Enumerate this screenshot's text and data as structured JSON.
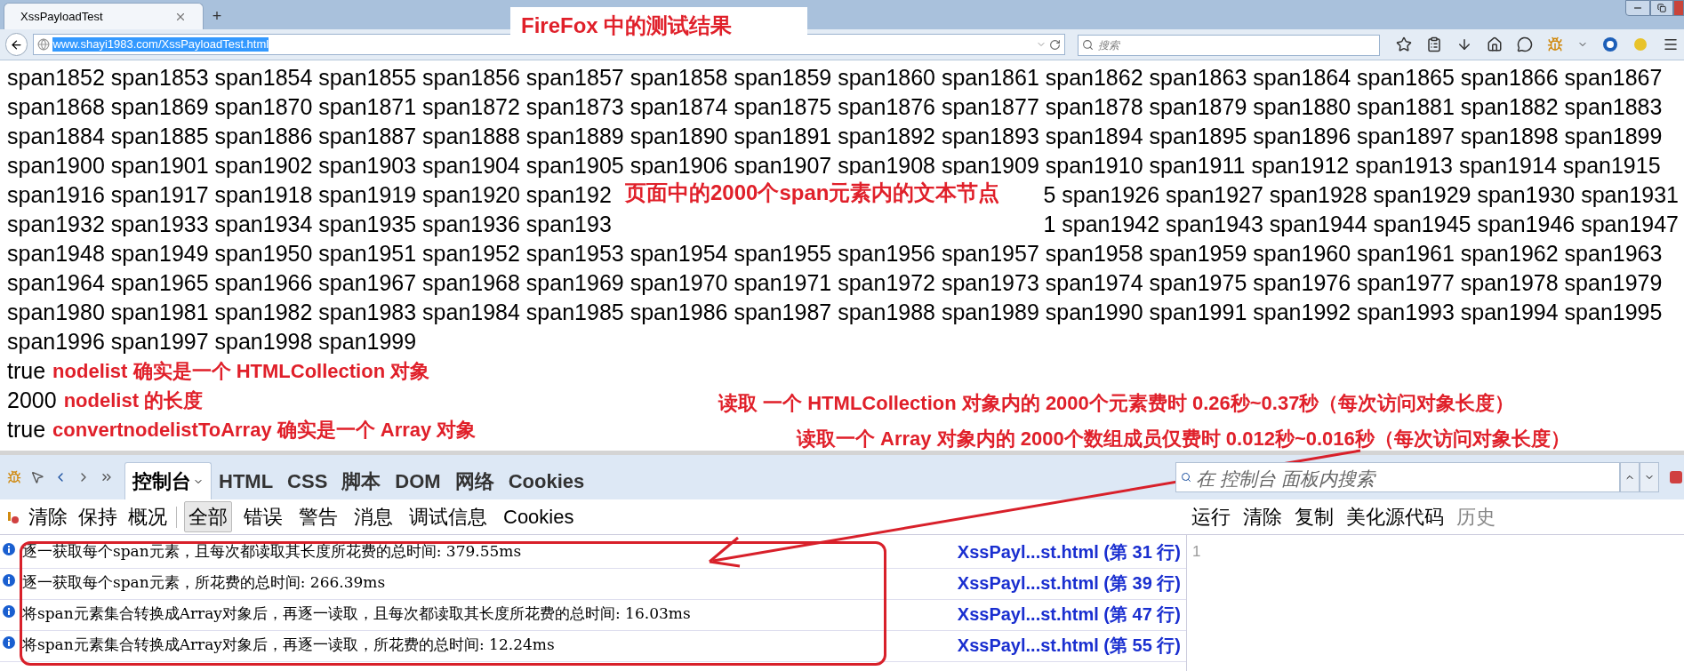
{
  "browser": {
    "tabs": [
      {
        "title": "XssPayloadTest",
        "selected": true
      }
    ],
    "new_tab": "+",
    "url": {
      "value": "www.shayi1983.com/XssPayloadTest.html",
      "highlighted": true
    },
    "search": {
      "placeholder": "搜索"
    }
  },
  "page": {
    "span_lines": [
      {
        "left": "span1852 span1853 span1854 span1855 span1856 span1857 span1858 span1859 span1860 span1861 span1862 span1863 span1864 span1865 span1866 span1867"
      },
      {
        "left": "span1868 span1869 span1870 span1871 span1872 span1873 span1874 span1875 span1876 span1877 span1878 span1879 span1880 span1881 span1882 span1883"
      },
      {
        "left": "span1884 span1885 span1886 span1887 span1888 span1889 span1890 span1891 span1892 span1893 span1894 span1895 span1896 span1897 span1898 span1899"
      },
      {
        "left": "span1900 span1901 span1902 span1903 span1904 span1905 span1906 span1907 span1908 span1909 span1910 span1911 span1912 span1913 span1914 span1915"
      },
      {
        "left": "span1916 span1917 span1918 span1919 span1920 span192",
        "right": "5 span1926 span1927 span1928 span1929 span1930 span1931"
      },
      {
        "left": "span1932 span1933 span1934 span1935 span1936 span193",
        "right": "1 span1942 span1943 span1944 span1945 span1946 span1947"
      },
      {
        "left": "span1948 span1949 span1950 span1951 span1952 span1953 span1954 span1955 span1956 span1957 span1958 span1959 span1960 span1961 span1962 span1963"
      },
      {
        "left": "span1964 span1965 span1966 span1967 span1968 span1969 span1970 span1971 span1972 span1973 span1974 span1975 span1976 span1977 span1978 span1979"
      },
      {
        "left": "span1980 span1981 span1982 span1983 span1984 span1985 span1986 span1987 span1988 span1989 span1990 span1991 span1992 span1993 span1994 span1995"
      },
      {
        "left": "span1996 span1997 span1998 span1999"
      }
    ],
    "results": [
      {
        "value": "true",
        "note": "nodelist 确实是一个 HTMLCollection 对象"
      },
      {
        "value": "2000",
        "note": "nodelist 的长度"
      },
      {
        "value": "true",
        "note": "convertnodelistToArray 确实是一个 Array 对象"
      }
    ]
  },
  "firebug": {
    "panel_tabs": [
      {
        "label": "控制台",
        "selected": true
      },
      {
        "label": "HTML",
        "selected": false
      },
      {
        "label": "CSS",
        "selected": false
      },
      {
        "label": "脚本",
        "selected": false
      },
      {
        "label": "DOM",
        "selected": false
      },
      {
        "label": "网络",
        "selected": false
      },
      {
        "label": "Cookies",
        "selected": false
      }
    ],
    "search": {
      "placeholder": "在 控制台 面板内搜索"
    },
    "actions": [
      "清除",
      "保持",
      "概况"
    ],
    "filters": [
      {
        "label": "全部",
        "selected": true
      },
      {
        "label": "错误",
        "selected": false
      },
      {
        "label": "警告",
        "selected": false
      },
      {
        "label": "消息",
        "selected": false
      },
      {
        "label": "调试信息",
        "selected": false
      },
      {
        "label": "Cookies",
        "selected": false
      }
    ],
    "editor_actions": [
      {
        "label": "运行",
        "disabled": false
      },
      {
        "label": "清除",
        "disabled": false
      },
      {
        "label": "复制",
        "disabled": false
      },
      {
        "label": "美化源代码",
        "disabled": false
      },
      {
        "label": "历史",
        "disabled": true
      }
    ],
    "log": [
      {
        "message": "逐一获取每个span元素，且每次都读取其长度所花费的总时间: 379.55ms",
        "source": "XssPayl...st.html (第 31 行)"
      },
      {
        "message": "逐一获取每个span元素，所花费的总时间: 266.39ms",
        "source": "XssPayl...st.html (第 39 行)"
      },
      {
        "message": "将span元素集合转换成Array对象后，再逐一读取，且每次都读取其长度所花费的总时间: 16.03ms",
        "source": "XssPayl...st.html (第 47 行)"
      },
      {
        "message": "将span元素集合转换成Array对象后，再逐一读取，所花费的总时间: 12.24ms",
        "source": "XssPayl...st.html (第 55 行)"
      }
    ],
    "editor_line": "1"
  },
  "annotations": {
    "title": "FireFox 中的测试结果",
    "span_note": "页面中的2000个span元素内的文本节点",
    "read_notes": [
      "读取 一个 HTMLCollection 对象内的 2000个元素费时 0.26秒~0.37秒（每次访问对象长度）",
      "读取一个 Array 对象内的 2000个数组成员仅费时 0.012秒~0.016秒（每次访问对象长度）"
    ]
  }
}
